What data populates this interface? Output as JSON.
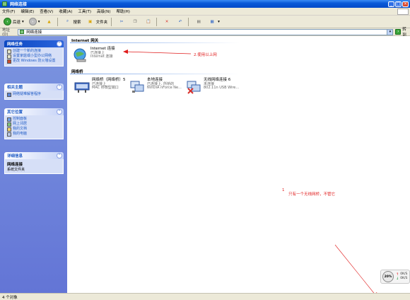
{
  "window": {
    "title": "网络连接"
  },
  "menu": {
    "items": [
      "文件(F)",
      "编辑(E)",
      "查看(V)",
      "收藏(A)",
      "工具(T)",
      "高级(N)",
      "帮助(H)"
    ]
  },
  "toolbar": {
    "back_label": "后退",
    "search_label": "搜索",
    "folders_label": "文件夹"
  },
  "address": {
    "label": "地址(D)",
    "value": "网络连接",
    "go_label": "转到"
  },
  "taskpane": {
    "network_tasks": {
      "title": "网络任务",
      "items": [
        "创建一个新的连接",
        "设置家庭或小型办公网络",
        "更改 Windows 防火墙设置"
      ]
    },
    "see_also": {
      "title": "相关主题",
      "items": [
        "网络疑难解答程序"
      ]
    },
    "other_places": {
      "title": "其它位置",
      "items": [
        "控制面板",
        "网上邻居",
        "我的文档",
        "我的电脑"
      ]
    },
    "details": {
      "title": "详细信息",
      "name": "网络连接",
      "type": "系统文件夹"
    }
  },
  "groups": {
    "internet": {
      "title": "Internet 网关",
      "connections": [
        {
          "name": "Internet 连接",
          "status": "已连接上",
          "device": "Internet 连接"
        }
      ]
    },
    "lan": {
      "title": "网络桥",
      "connections": [
        {
          "name": "网络桥（网络桥）5",
          "status": "已连接上",
          "device": "MAC 桥微型端口"
        },
        {
          "name": "本地连接",
          "status": "已连接上, 所桥的",
          "device": "NVIDIA nForce Ne..."
        },
        {
          "name": "无线网络连接 6",
          "status": "未连接",
          "device": "802.11n USB Wire..."
        }
      ]
    }
  },
  "annotations": {
    "note1": "2.使用以上网",
    "note2_num": "1",
    "note2": "只有一个无线网桥，不管它"
  },
  "tray": {
    "badge": "20%",
    "up_value": "0K/S",
    "down_value": "0K/S"
  },
  "status": {
    "text": "4 个对象"
  },
  "colors": {
    "titlebar": "#0a5ad8",
    "taskpane": "#6375d6",
    "annotation": "#e01c1c"
  }
}
